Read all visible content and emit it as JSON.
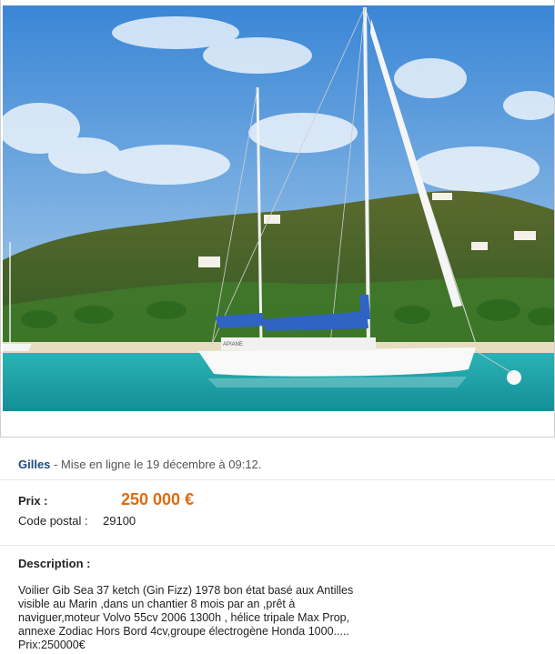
{
  "listing": {
    "seller_name": "Gilles",
    "posted_text": " - Mise en ligne le 19 décembre à 09:12.",
    "price_label": "Prix :",
    "price_value": "250 000 €",
    "postal_label": "Code postal :",
    "postal_value": "29100",
    "description_title": "Description :",
    "description_text": "Voilier Gib Sea 37 ketch (Gin Fizz) 1978 bon état basé aux Antilles\nvisible au Marin ,dans un chantier 8 mois par an ,prêt à\nnaviguer,moteur Volvo 55cv 2006 1300h , hélice tripale Max Prop,\nannexe Zodiac Hors Bord 4cv,groupe électrogène Honda 1000.....\nPrix:250000€"
  },
  "photo": {
    "boat_name": "APIANE"
  },
  "colors": {
    "seller": "#1a4d80",
    "price": "#e06b0e",
    "sea": "#1fa3a8",
    "sky": "#4a8fd6"
  }
}
